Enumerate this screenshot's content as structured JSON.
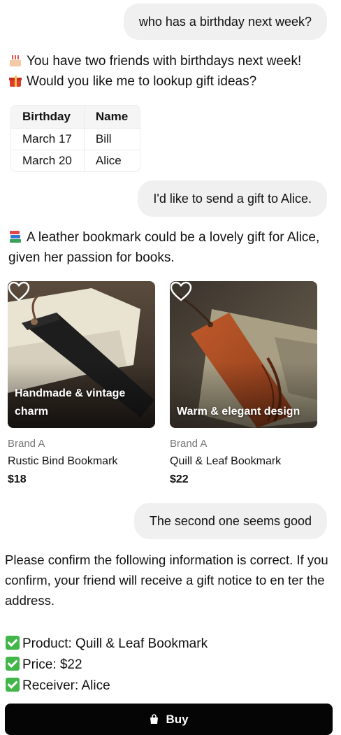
{
  "messages": {
    "user1": "who has a birthday next week?",
    "assistant1_line1": "You have two friends with birthdays next week!",
    "assistant1_line2": "Would you like me to lookup gift ideas?",
    "user2": "I'd like to send a gift to Alice.",
    "assistant2": "A leather bookmark could be a lovely gift for Alice, given her passion for books.",
    "user3": "The second one seems good",
    "assistant3": "Please confirm the following information is correct. If you confirm, your friend will receive a gift notice to en ter the address."
  },
  "table": {
    "headers": [
      "Birthday",
      "Name"
    ],
    "rows": [
      [
        "March 17",
        "Bill"
      ],
      [
        "March 20",
        "Alice"
      ]
    ]
  },
  "products": [
    {
      "tagline": "Handmade & vintage charm",
      "brand": "Brand A",
      "name": "Rustic Bind Bookmark",
      "price": "$18"
    },
    {
      "tagline": "Warm & elegant design",
      "brand": "Brand A",
      "name": "Quill & Leaf Bookmark",
      "price": "$22"
    }
  ],
  "confirm": {
    "items": [
      "Product: Quill & Leaf Bookmark",
      "Price: $22",
      "Receiver: Alice"
    ]
  },
  "buy_button": {
    "label": "Buy"
  },
  "colors": {
    "user_bubble": "#f0f0f0",
    "buy_button_bg": "#050505",
    "check_green": "#43b649",
    "brand_gray": "#777777"
  }
}
